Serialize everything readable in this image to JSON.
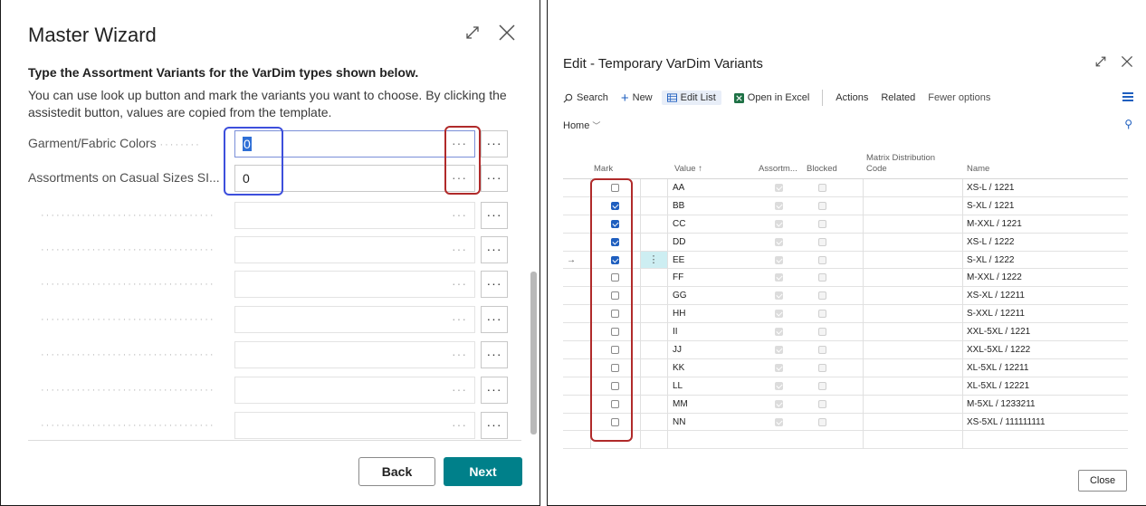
{
  "wizard": {
    "title": "Master Wizard",
    "heading": "Type the Assortment Variants for the VarDim types shown below.",
    "description": "You can use look up button and mark the variants you want to choose. By clicking the assistedit button, values are copied from the template.",
    "fields": [
      {
        "label": "Garment/Fabric Colors",
        "value": "0"
      },
      {
        "label": "Assortments on Casual Sizes SI...",
        "value": "0"
      }
    ],
    "ellipsis": "···",
    "assist_label": "···",
    "back_label": "Back",
    "next_label": "Next"
  },
  "variants": {
    "title": "Edit - Temporary VarDim Variants",
    "toolbar": {
      "search": "Search",
      "new": "New",
      "edit_list": "Edit List",
      "open_in_excel": "Open in Excel",
      "actions": "Actions",
      "related": "Related",
      "fewer_options": "Fewer options"
    },
    "home_tab": "Home",
    "columns": {
      "mark": "Mark",
      "value": "Value ↑",
      "assortment": "Assortm...",
      "blocked": "Blocked",
      "matrix_line1": "Matrix Distribution",
      "matrix_line2": "Code",
      "name": "Name"
    },
    "rows": [
      {
        "mark": false,
        "value": "AA",
        "assortment": true,
        "name": "XS-L / 1221"
      },
      {
        "mark": true,
        "value": "BB",
        "assortment": true,
        "name": "S-XL / 1221"
      },
      {
        "mark": true,
        "value": "CC",
        "assortment": true,
        "name": "M-XXL / 1221"
      },
      {
        "mark": true,
        "value": "DD",
        "assortment": true,
        "name": "XS-L / 1222"
      },
      {
        "mark": true,
        "value": "EE",
        "assortment": true,
        "name": "S-XL / 1222"
      },
      {
        "mark": false,
        "value": "FF",
        "assortment": true,
        "name": "M-XXL / 1222"
      },
      {
        "mark": false,
        "value": "GG",
        "assortment": true,
        "name": "XS-XL / 12211"
      },
      {
        "mark": false,
        "value": "HH",
        "assortment": true,
        "name": "S-XXL / 12211"
      },
      {
        "mark": false,
        "value": "II",
        "assortment": true,
        "name": "XXL-5XL / 1221"
      },
      {
        "mark": false,
        "value": "JJ",
        "assortment": true,
        "name": "XXL-5XL / 1222"
      },
      {
        "mark": false,
        "value": "KK",
        "assortment": true,
        "name": "XL-5XL / 12211"
      },
      {
        "mark": false,
        "value": "LL",
        "assortment": true,
        "name": "XL-5XL / 12221"
      },
      {
        "mark": false,
        "value": "MM",
        "assortment": true,
        "name": "M-5XL / 1233211"
      },
      {
        "mark": false,
        "value": "NN",
        "assortment": true,
        "name": "XS-5XL / 111111111"
      }
    ],
    "current_row_arrow": "→",
    "row_menu": "⋮",
    "close_label": "Close"
  },
  "colors": {
    "accent": "#00808a",
    "highlight_blue": "#3d4fdc",
    "highlight_red": "#b02a2a",
    "checkbox_blue": "#1f5fbf"
  }
}
